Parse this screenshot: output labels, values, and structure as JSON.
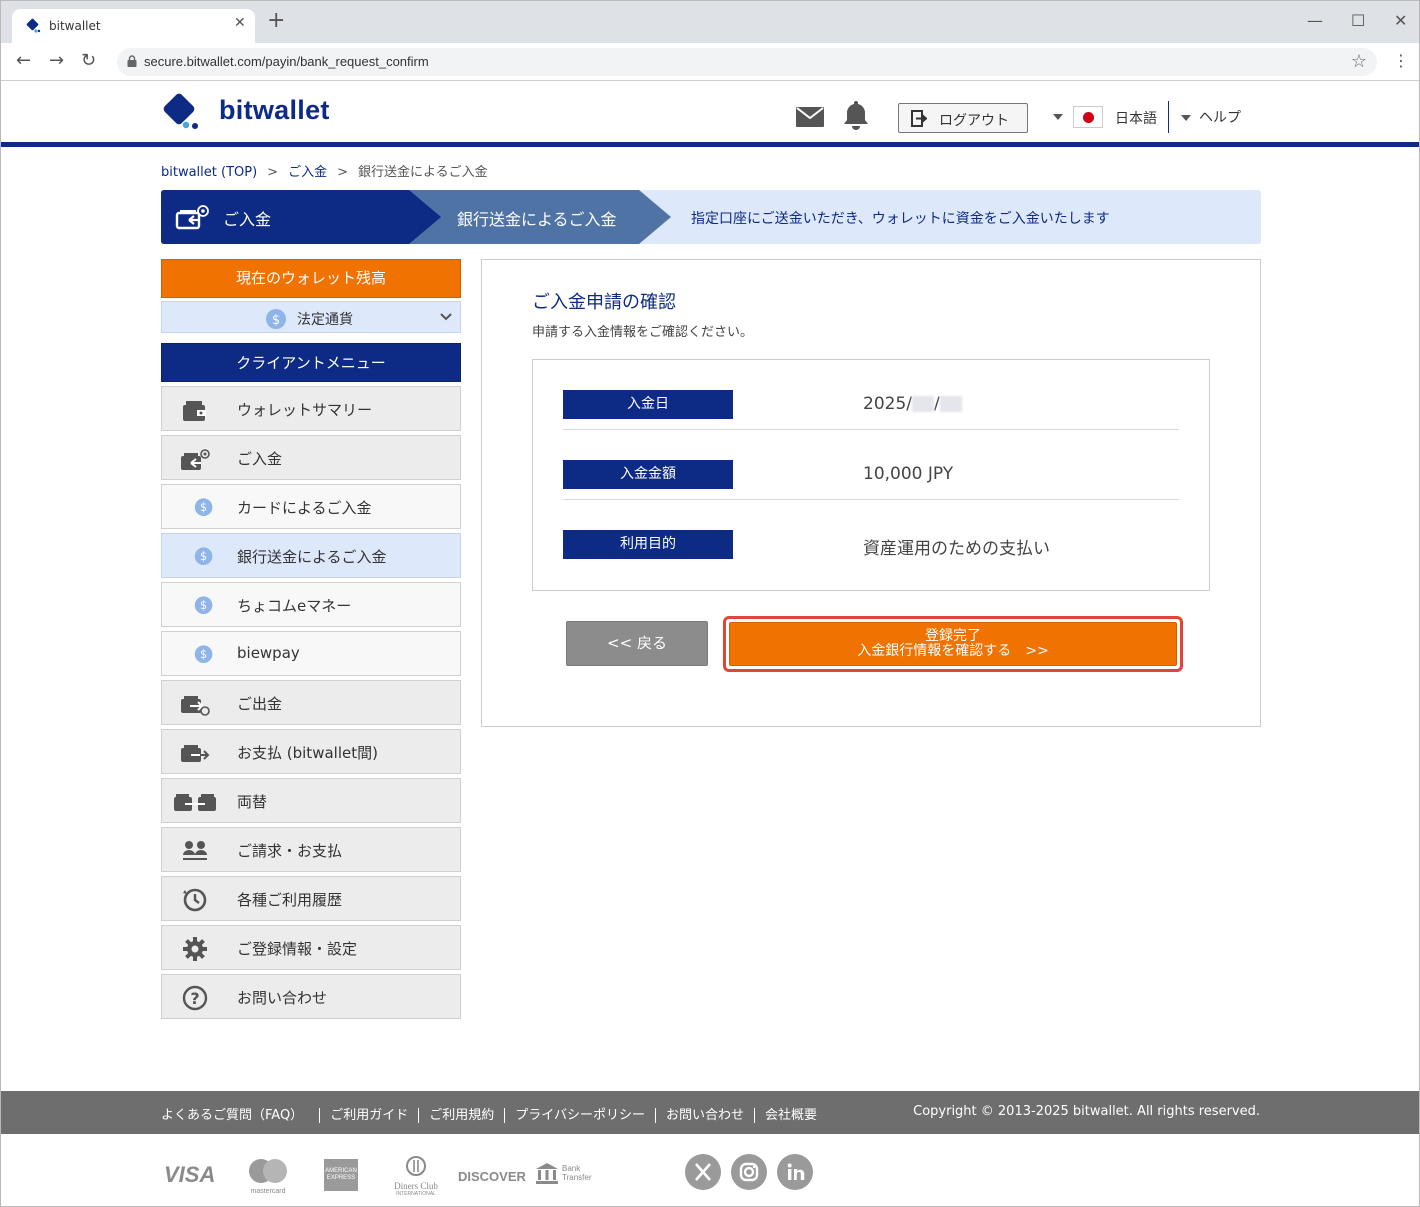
{
  "browser": {
    "tab_title": "bitwallet",
    "url": "secure.bitwallet.com/payin/bank_request_confirm"
  },
  "header": {
    "logo_text": "bitwallet",
    "logout_label": "ログアウト",
    "language_label": "日本語",
    "help_label": "ヘルプ"
  },
  "breadcrumb": {
    "items": [
      "bitwallet (TOP)",
      "ご入金",
      "銀行送金によるご入金"
    ],
    "separator": ">"
  },
  "steps": {
    "step1": "ご入金",
    "step2": "銀行送金によるご入金",
    "step3": "指定口座にご送金いただき、ウォレットに資金をご入金いたします"
  },
  "sidebar": {
    "balance_header": "現在のウォレット残高",
    "currency_label": "法定通貨",
    "menu_header": "クライアントメニュー",
    "items": [
      {
        "label": "ウォレットサマリー",
        "icon": "wallet-icon"
      },
      {
        "label": "ご入金",
        "icon": "deposit-icon"
      },
      {
        "label": "カードによるご入金",
        "icon": "dollar-coin-icon"
      },
      {
        "label": "銀行送金によるご入金",
        "icon": "dollar-coin-icon"
      },
      {
        "label": "ちょコムeマネー",
        "icon": "dollar-coin-icon"
      },
      {
        "label": "biewpay",
        "icon": "dollar-coin-icon"
      },
      {
        "label": "ご出金",
        "icon": "withdraw-icon"
      },
      {
        "label": "お支払 (bitwallet間)",
        "icon": "payment-icon"
      },
      {
        "label": "両替",
        "icon": "exchange-icon"
      },
      {
        "label": "ご請求・お支払",
        "icon": "people-icon"
      },
      {
        "label": "各種ご利用履歴",
        "icon": "history-icon"
      },
      {
        "label": "ご登録情報・設定",
        "icon": "gear-icon"
      },
      {
        "label": "お問い合わせ",
        "icon": "question-icon"
      }
    ]
  },
  "main": {
    "title": "ご入金申請の確認",
    "subtitle": "申請する入金情報をご確認ください。",
    "rows": [
      {
        "label": "入金日",
        "value": "2025/",
        "value_sep": "/"
      },
      {
        "label": "入金金額",
        "value": "10,000 JPY"
      },
      {
        "label": "利用目的",
        "value": "資産運用のための支払い"
      }
    ],
    "back_button": "<< 戻る",
    "confirm_button_line1": "登録完了",
    "confirm_button_line2": "入金銀行情報を確認する　>>"
  },
  "footer": {
    "links": [
      "よくあるご質問（FAQ）",
      "ご利用ガイド",
      "ご利用規約",
      "プライバシーポリシー",
      "お問い合わせ",
      "会社概要"
    ],
    "copyright": "Copyright © 2013-2025 bitwallet. All rights reserved."
  },
  "payments": {
    "visa": "VISA",
    "mastercard": "mastercard",
    "amex": "AMERICAN EXPRESS",
    "diners": "Diners Club",
    "diners_sub": "INTERNATIONAL",
    "discover": "DISCOVER",
    "bank": "Bank",
    "bank_sub": "Transfer"
  },
  "colors": {
    "brand_navy": "#0d2b84",
    "accent_orange": "#f07200",
    "highlight_red": "#e0453a",
    "step_light": "#dde8fb"
  }
}
